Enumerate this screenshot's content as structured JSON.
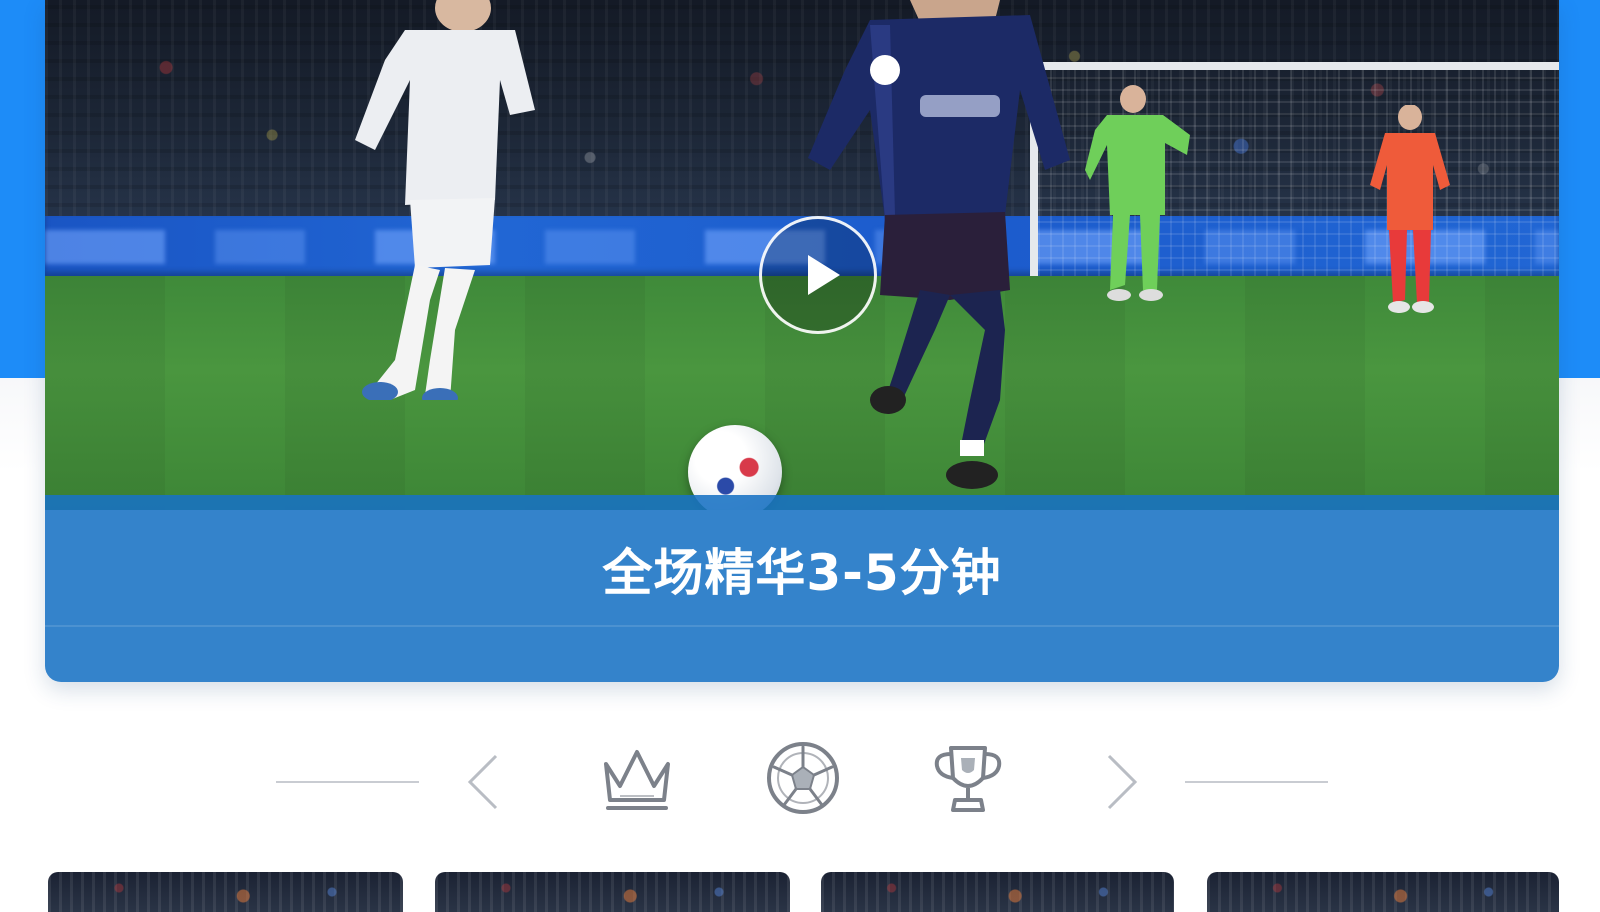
{
  "video": {
    "caption": "全场精华3-5分钟",
    "play_icon": "play-icon"
  },
  "category_nav": {
    "prev_icon": "chevron-left-icon",
    "next_icon": "chevron-right-icon",
    "items": [
      {
        "name": "crown-icon"
      },
      {
        "name": "football-icon"
      },
      {
        "name": "trophy-icon"
      }
    ]
  },
  "thumbnails": {
    "count_visible": 4
  },
  "colors": {
    "header_blue": "#1d8cf8",
    "caption_blue": "#1872c4",
    "icon_gray": "#7c818a",
    "divider_gray": "#c9ccd2"
  }
}
